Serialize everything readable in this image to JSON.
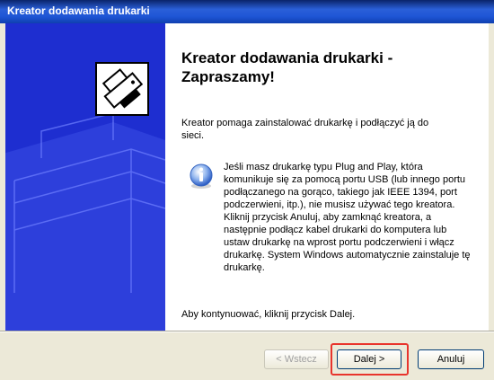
{
  "window": {
    "title": "Kreator dodawania drukarki"
  },
  "main": {
    "heading": "Kreator dodawania drukarki - Zapraszamy!",
    "intro": "Kreator pomaga zainstalować drukarkę i podłączyć ją do sieci.",
    "info": "Jeśli masz drukarkę typu Plug and Play, która komunikuje się za pomocą portu USB (lub innego portu podłączanego na gorąco, takiego jak IEEE 1394, port podczerwieni, itp.), nie musisz używać tego kreatora. Kliknij przycisk Anuluj, aby zamknąć kreatora, a następnie podłącz kabel drukarki do komputera lub ustaw drukarkę na wprost portu podczerwieni i włącz drukarkę. System Windows automatycznie zainstaluje tę drukarkę.",
    "continue": "Aby kontynuować, kliknij przycisk Dalej."
  },
  "buttons": {
    "back": "< Wstecz",
    "next": "Dalej >",
    "cancel": "Anuluj"
  },
  "icons": {
    "sidebar": "printer-icon",
    "info": "info-icon"
  },
  "colors": {
    "sidebar": "#1e2ed0",
    "title_bar": "#1f56d6",
    "highlight": "#e8342c"
  }
}
